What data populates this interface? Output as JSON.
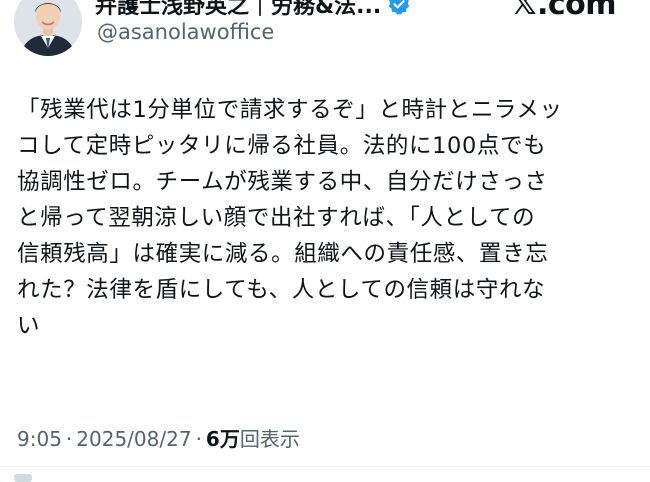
{
  "header": {
    "display_name": "弁護士浅野英之｜労務&法...",
    "handle": "@asanolawoffice",
    "brand_text": ".com",
    "verified_icon": "verified-badge-icon",
    "brand_icon": "x-logo-icon",
    "colors": {
      "verified": "#1d9bf0"
    }
  },
  "tweet": {
    "lines": [
      "「残業代は1分単位で請求するぞ」と時計とニラメッ",
      "コして定時ピッタリに帰る社員。法的に100点でも",
      "協調性ゼロ。チームが残業する中、自分だけさっさ",
      "と帰って翌朝涼しい顔で出社すれば、「人としての",
      "信頼残高」は確実に減る。組織への責任感、置き忘",
      "れた？法律を盾にしても、人としての信頼は守れな",
      "い"
    ]
  },
  "meta": {
    "time": "9:05",
    "separator": "·",
    "date": "2025/08/27",
    "views_count": "6万",
    "views_label": "回表示"
  }
}
